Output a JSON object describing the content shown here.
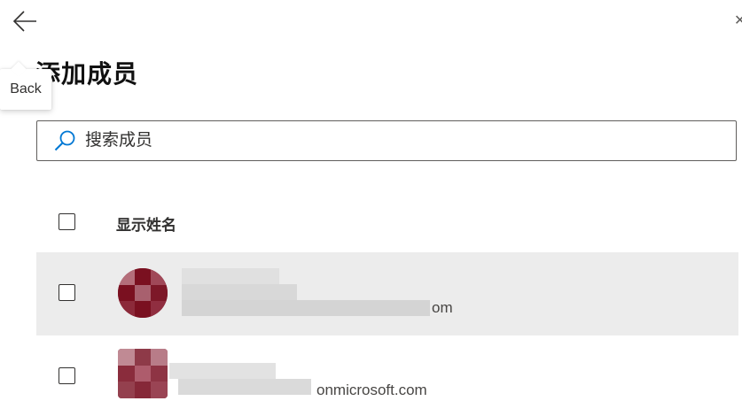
{
  "nav": {
    "back_tooltip": "Back"
  },
  "page": {
    "title": "添加成员"
  },
  "search": {
    "placeholder": "搜索成员"
  },
  "table": {
    "header_display_name": "显示姓名",
    "rows": [
      {
        "email_visible_tail": "om",
        "selected": false,
        "highlighted": true
      },
      {
        "email_visible_tail": "onmicrosoft.com",
        "selected": false,
        "highlighted": false
      }
    ]
  },
  "colors": {
    "accent": "#0078d4",
    "avatar": "#8a2434",
    "row_hover": "#ececec"
  }
}
